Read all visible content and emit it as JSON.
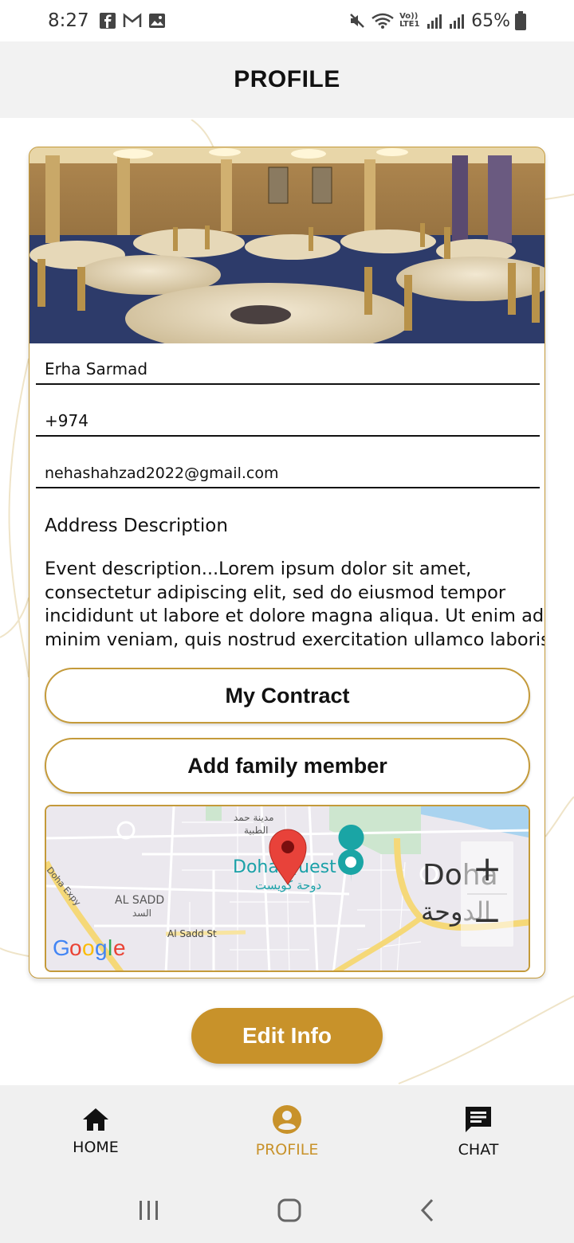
{
  "status_bar": {
    "time": "8:27",
    "battery": "65%",
    "network_label": "Vo)) LTE1"
  },
  "header": {
    "title": "PROFILE"
  },
  "profile": {
    "name": "Erha Sarmad",
    "phone": "+974",
    "email": "nehashahzad2022@gmail.com",
    "address_label": "Address Description",
    "address_lines": [
      "Event description...Lorem ipsum dolor sit amet,",
      "consectetur adipiscing elit, sed do eiusmod tempor",
      "incididunt ut labore et dolore magna aliqua. Ut enim ad",
      "minim veniam, quis nostrud exercitation ullamco laboris"
    ]
  },
  "buttons": {
    "contract": "My Contract",
    "add_family": "Add family member",
    "edit_info": "Edit Info"
  },
  "map": {
    "labels": {
      "place": "Doha Quest",
      "place_ar": "دوحة كويست",
      "district": "AL SADD",
      "district_ar": "السد",
      "street": "Al Sadd St",
      "road": "Doha Expy",
      "city": "Doha",
      "city_ar": "الدوحة",
      "medical_ar_1": "مدينة حمد",
      "medical_ar_2": "الطبية"
    },
    "brand": "Google",
    "zoom_in": "+",
    "zoom_out": "−"
  },
  "nav": {
    "home": "HOME",
    "profile": "PROFILE",
    "chat": "CHAT"
  },
  "colors": {
    "accent": "#c8922a",
    "card_border": "#c49a3a",
    "header_bg": "#f2f2f2"
  }
}
